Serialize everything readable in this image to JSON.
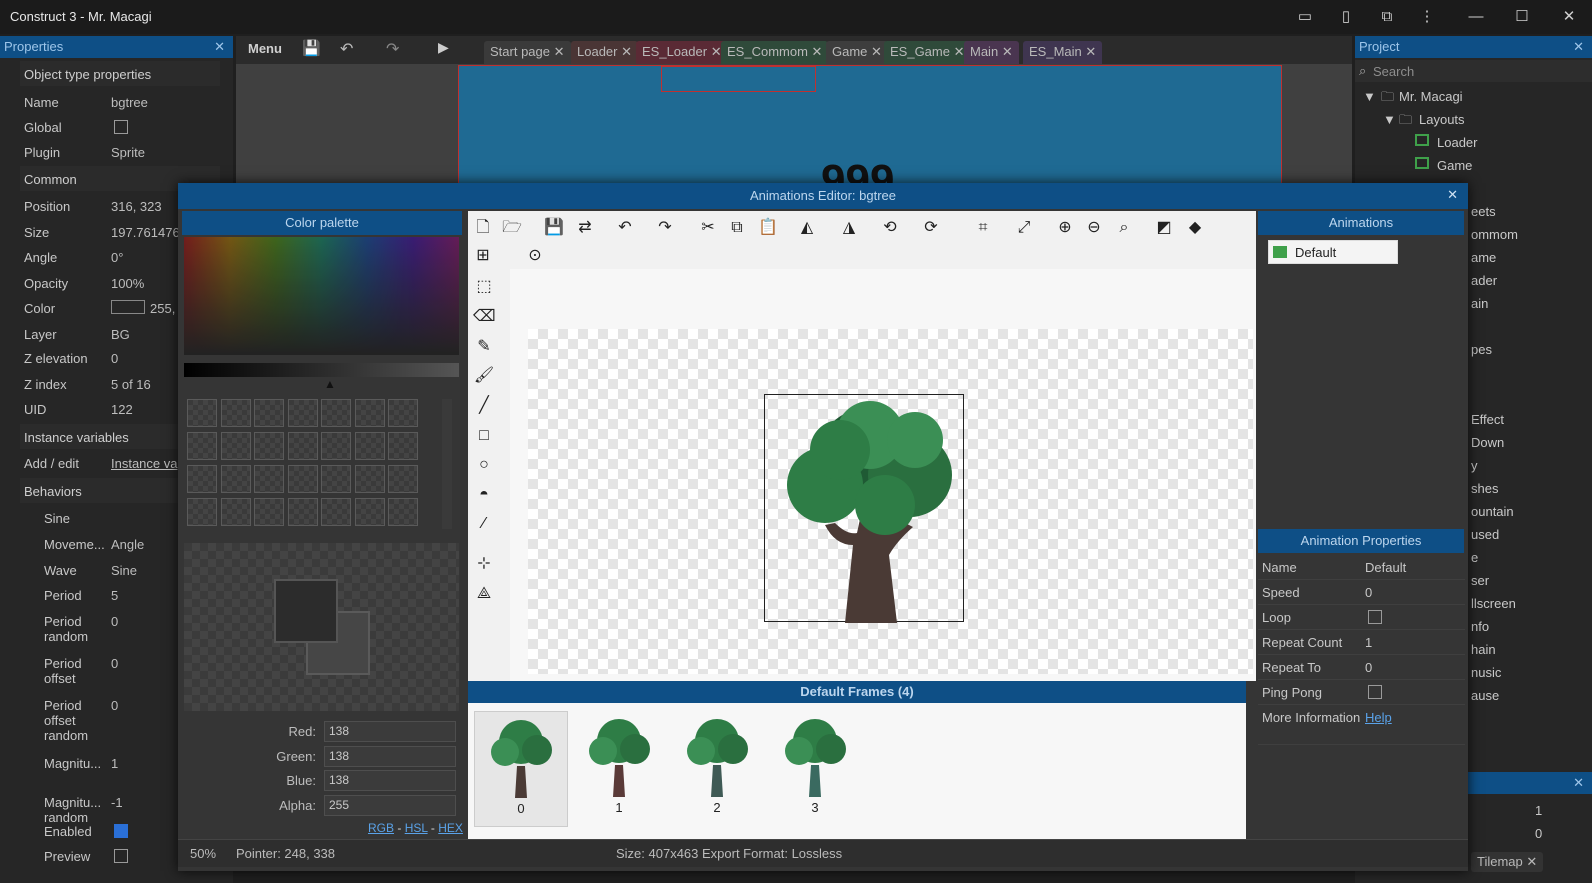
{
  "window": {
    "title": "Construct 3 - Mr. Macagi"
  },
  "properties": {
    "header": "Properties",
    "section": "Object type properties",
    "rows": [
      {
        "k": "Name",
        "v": "bgtree"
      },
      {
        "k": "Global",
        "v": ""
      },
      {
        "k": "Plugin",
        "v": "Sprite"
      }
    ],
    "common": "Common",
    "rows2": [
      {
        "k": "Position",
        "v": "316, 323"
      },
      {
        "k": "Size",
        "v": "197.761476"
      },
      {
        "k": "Angle",
        "v": "0°"
      },
      {
        "k": "Opacity",
        "v": "100%"
      },
      {
        "k": "Color",
        "v": "255,"
      },
      {
        "k": "Layer",
        "v": "BG"
      },
      {
        "k": "Z elevation",
        "v": "0"
      },
      {
        "k": "Z index",
        "v": "5 of 16"
      },
      {
        "k": "UID",
        "v": "122"
      }
    ],
    "instance_vars": "Instance variables",
    "add_edit": "Add / edit",
    "instance_link": "Instance va",
    "behaviors": "Behaviors",
    "sine": "Sine",
    "rows3": [
      {
        "k": "Moveme...",
        "v": "Angle"
      },
      {
        "k": "Wave",
        "v": "Sine"
      },
      {
        "k": "Period",
        "v": "5"
      },
      {
        "k": "Period random",
        "v": "0"
      },
      {
        "k": "Period offset",
        "v": "0"
      },
      {
        "k": "Period offset random",
        "v": "0"
      },
      {
        "k": "Magnitu...",
        "v": "1"
      },
      {
        "k": "Magnitu... random",
        "v": "-1"
      },
      {
        "k": "Enabled",
        "v": ""
      },
      {
        "k": "Preview",
        "v": ""
      }
    ]
  },
  "toolbar": {
    "menu": "Menu"
  },
  "tabs": [
    "Start page",
    "Loader",
    "ES_Loader",
    "ES_Commom",
    "Game",
    "ES_Game",
    "Main",
    "ES_Main"
  ],
  "layout": {
    "score": "999"
  },
  "project": {
    "header": "Project",
    "search_placeholder": "Search",
    "root": "Mr. Macagi",
    "layouts": "Layouts",
    "items": [
      "Loader",
      "Game"
    ],
    "partial": [
      "eets",
      "ommom",
      "ame",
      "ader",
      "ain",
      "pes",
      "Effect",
      "Down",
      "y",
      "shes",
      "ountain",
      "used",
      "e",
      "ser",
      "llscreen",
      "nfo",
      "hain",
      "nusic",
      "ause"
    ],
    "tilemap": "Tilemap",
    "right_vals": [
      "1",
      "0"
    ]
  },
  "dialog": {
    "title": "Animations Editor: bgtree",
    "color_palette": "Color palette",
    "animations": "Animations",
    "animation_item": "Default",
    "anim_props_header": "Animation Properties",
    "anim_props": [
      {
        "k": "Name",
        "v": "Default"
      },
      {
        "k": "Speed",
        "v": "0"
      },
      {
        "k": "Loop",
        "v": ""
      },
      {
        "k": "Repeat Count",
        "v": "1"
      },
      {
        "k": "Repeat To",
        "v": "0"
      },
      {
        "k": "Ping Pong",
        "v": ""
      },
      {
        "k": "More Information",
        "v": "Help"
      }
    ],
    "frames_header": "Default Frames (4)",
    "frames": [
      "0",
      "1",
      "2",
      "3"
    ],
    "rgba": {
      "red_label": "Red:",
      "red": "138",
      "green_label": "Green:",
      "green": "138",
      "blue_label": "Blue:",
      "blue": "138",
      "alpha_label": "Alpha:",
      "alpha": "255"
    },
    "links": {
      "rgb": "RGB",
      "hsl": "HSL",
      "hex": "HEX",
      "sep": " - "
    },
    "status": {
      "zoom": "50%",
      "pointer": "Pointer: 248, 338",
      "size": "Size: 407x463",
      "format": "Export Format: Lossless"
    }
  },
  "colors": {
    "accent": "#0e4f86",
    "tree_dark": "#1f5a34",
    "tree_mid": "#2e7d46",
    "trunk": "#4a3a35"
  }
}
